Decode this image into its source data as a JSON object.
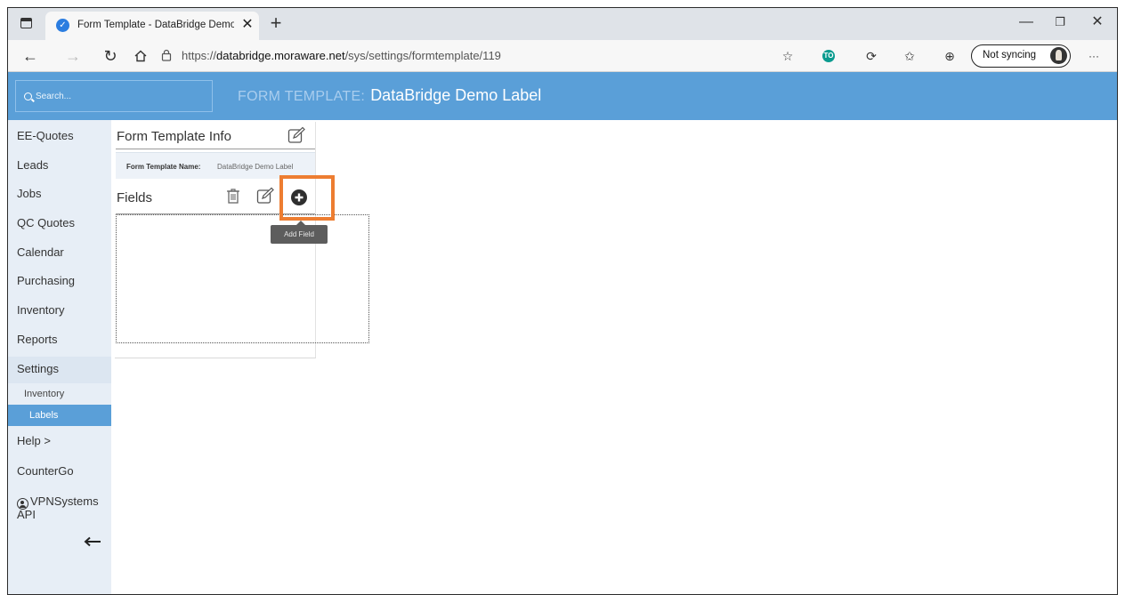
{
  "browser": {
    "tab_title": "Form Template - DataBridge Demo Label",
    "url_scheme": "https://",
    "url_host": "databridge.moraware.net",
    "url_path": "/sys/settings/formtemplate/119",
    "sync_label": "Not syncing",
    "extension_badge": "TO"
  },
  "header": {
    "search_placeholder": "Search...",
    "title_prefix": "FORM TEMPLATE:",
    "title_name": "DataBridge Demo Label"
  },
  "sidebar": {
    "items": [
      "EE-Quotes",
      "Leads",
      "Jobs",
      "QC Quotes",
      "Calendar",
      "Purchasing",
      "Inventory",
      "Reports",
      "Settings"
    ],
    "sub_items": [
      "Inventory",
      "Labels"
    ],
    "help": "Help >",
    "countergo": "CounterGo",
    "user_line1": "VPNSystems",
    "user_line2": "API"
  },
  "main": {
    "info_title": "Form Template Info",
    "name_label": "Form Template Name:",
    "name_value": "DataBridge Demo Label",
    "fields_title": "Fields",
    "tooltip": "Add Field"
  },
  "colors": {
    "header_blue": "#5a9fd8",
    "highlight_orange": "#ed7d31",
    "sidebar_bg": "#e7eef6"
  }
}
